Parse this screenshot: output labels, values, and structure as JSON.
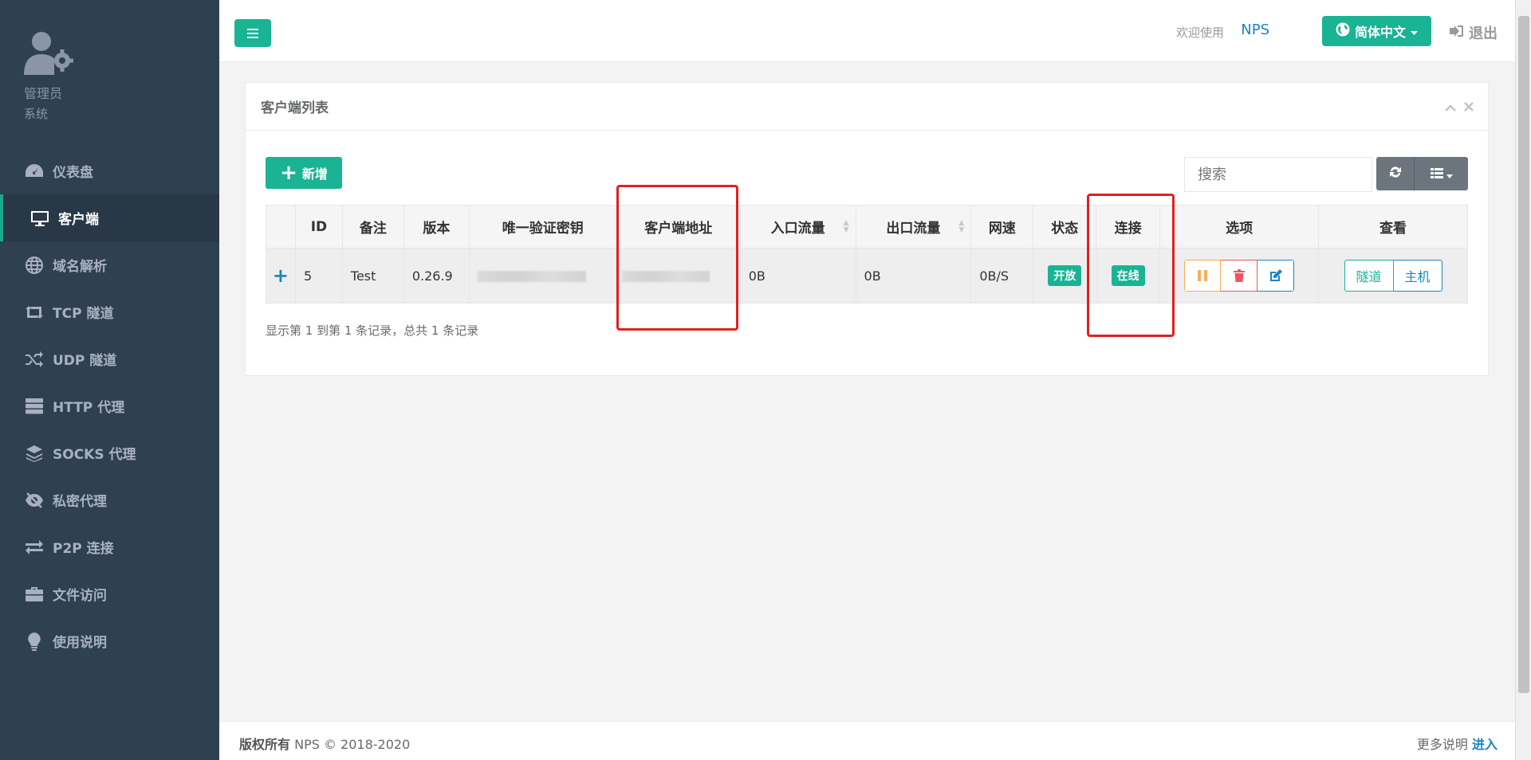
{
  "sidebar": {
    "profile": {
      "name": "管理员",
      "role": "系统"
    },
    "items": [
      {
        "label": "仪表盘",
        "icon": "dashboard-icon"
      },
      {
        "label": "客户端",
        "icon": "desktop-icon",
        "active": true
      },
      {
        "label": "域名解析",
        "icon": "globe-icon"
      },
      {
        "label": "TCP 隧道",
        "icon": "retweet-icon"
      },
      {
        "label": "UDP 隧道",
        "icon": "random-icon"
      },
      {
        "label": "HTTP 代理",
        "icon": "server-icon"
      },
      {
        "label": "SOCKS 代理",
        "icon": "layers-icon"
      },
      {
        "label": "私密代理",
        "icon": "eye-slash-icon"
      },
      {
        "label": "P2P 连接",
        "icon": "exchange-icon"
      },
      {
        "label": "文件访问",
        "icon": "briefcase-icon"
      },
      {
        "label": "使用说明",
        "icon": "lightbulb-icon"
      }
    ]
  },
  "topbar": {
    "welcome": "欢迎使用",
    "brand": "NPS",
    "language": "简体中文",
    "logout": "退出"
  },
  "panel": {
    "title": "客户端列表",
    "add_label": "新增",
    "search_placeholder": "搜索",
    "columns": [
      "ID",
      "备注",
      "版本",
      "唯一验证密钥",
      "客户端地址",
      "入口流量",
      "出口流量",
      "网速",
      "状态",
      "连接",
      "选项",
      "查看"
    ],
    "rows": [
      {
        "id": "5",
        "remark": "Test",
        "version": "0.26.9",
        "in_traffic": "0B",
        "out_traffic": "0B",
        "speed": "0B/S",
        "status": "开放",
        "connection": "在线",
        "view_tunnel": "隧道",
        "view_host": "主机"
      }
    ],
    "pagination": "显示第 1 到第 1 条记录，总共 1 条记录"
  },
  "footer": {
    "copyright_label": "版权所有",
    "copyright_text": " NPS © 2018-2020",
    "more_label": "更多说明",
    "more_link": "进入"
  }
}
